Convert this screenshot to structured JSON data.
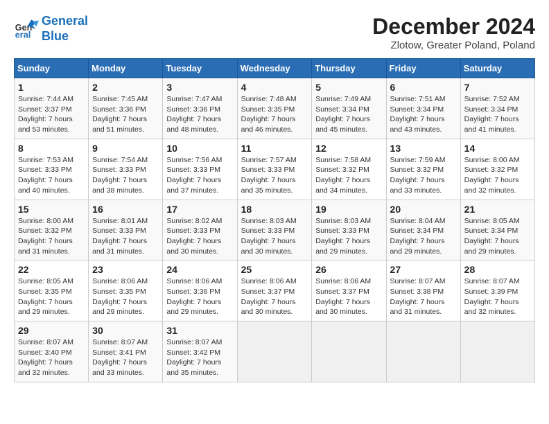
{
  "header": {
    "logo_line1": "General",
    "logo_line2": "Blue",
    "title": "December 2024",
    "subtitle": "Zlotow, Greater Poland, Poland"
  },
  "weekdays": [
    "Sunday",
    "Monday",
    "Tuesday",
    "Wednesday",
    "Thursday",
    "Friday",
    "Saturday"
  ],
  "weeks": [
    [
      {
        "day": "1",
        "sunrise": "7:44 AM",
        "sunset": "3:37 PM",
        "daylight": "7 hours and 53 minutes."
      },
      {
        "day": "2",
        "sunrise": "7:45 AM",
        "sunset": "3:36 PM",
        "daylight": "7 hours and 51 minutes."
      },
      {
        "day": "3",
        "sunrise": "7:47 AM",
        "sunset": "3:36 PM",
        "daylight": "7 hours and 48 minutes."
      },
      {
        "day": "4",
        "sunrise": "7:48 AM",
        "sunset": "3:35 PM",
        "daylight": "7 hours and 46 minutes."
      },
      {
        "day": "5",
        "sunrise": "7:49 AM",
        "sunset": "3:34 PM",
        "daylight": "7 hours and 45 minutes."
      },
      {
        "day": "6",
        "sunrise": "7:51 AM",
        "sunset": "3:34 PM",
        "daylight": "7 hours and 43 minutes."
      },
      {
        "day": "7",
        "sunrise": "7:52 AM",
        "sunset": "3:34 PM",
        "daylight": "7 hours and 41 minutes."
      }
    ],
    [
      {
        "day": "8",
        "sunrise": "7:53 AM",
        "sunset": "3:33 PM",
        "daylight": "7 hours and 40 minutes."
      },
      {
        "day": "9",
        "sunrise": "7:54 AM",
        "sunset": "3:33 PM",
        "daylight": "7 hours and 38 minutes."
      },
      {
        "day": "10",
        "sunrise": "7:56 AM",
        "sunset": "3:33 PM",
        "daylight": "7 hours and 37 minutes."
      },
      {
        "day": "11",
        "sunrise": "7:57 AM",
        "sunset": "3:33 PM",
        "daylight": "7 hours and 35 minutes."
      },
      {
        "day": "12",
        "sunrise": "7:58 AM",
        "sunset": "3:32 PM",
        "daylight": "7 hours and 34 minutes."
      },
      {
        "day": "13",
        "sunrise": "7:59 AM",
        "sunset": "3:32 PM",
        "daylight": "7 hours and 33 minutes."
      },
      {
        "day": "14",
        "sunrise": "8:00 AM",
        "sunset": "3:32 PM",
        "daylight": "7 hours and 32 minutes."
      }
    ],
    [
      {
        "day": "15",
        "sunrise": "8:00 AM",
        "sunset": "3:32 PM",
        "daylight": "7 hours and 31 minutes."
      },
      {
        "day": "16",
        "sunrise": "8:01 AM",
        "sunset": "3:33 PM",
        "daylight": "7 hours and 31 minutes."
      },
      {
        "day": "17",
        "sunrise": "8:02 AM",
        "sunset": "3:33 PM",
        "daylight": "7 hours and 30 minutes."
      },
      {
        "day": "18",
        "sunrise": "8:03 AM",
        "sunset": "3:33 PM",
        "daylight": "7 hours and 30 minutes."
      },
      {
        "day": "19",
        "sunrise": "8:03 AM",
        "sunset": "3:33 PM",
        "daylight": "7 hours and 29 minutes."
      },
      {
        "day": "20",
        "sunrise": "8:04 AM",
        "sunset": "3:34 PM",
        "daylight": "7 hours and 29 minutes."
      },
      {
        "day": "21",
        "sunrise": "8:05 AM",
        "sunset": "3:34 PM",
        "daylight": "7 hours and 29 minutes."
      }
    ],
    [
      {
        "day": "22",
        "sunrise": "8:05 AM",
        "sunset": "3:35 PM",
        "daylight": "7 hours and 29 minutes."
      },
      {
        "day": "23",
        "sunrise": "8:06 AM",
        "sunset": "3:35 PM",
        "daylight": "7 hours and 29 minutes."
      },
      {
        "day": "24",
        "sunrise": "8:06 AM",
        "sunset": "3:36 PM",
        "daylight": "7 hours and 29 minutes."
      },
      {
        "day": "25",
        "sunrise": "8:06 AM",
        "sunset": "3:37 PM",
        "daylight": "7 hours and 30 minutes."
      },
      {
        "day": "26",
        "sunrise": "8:06 AM",
        "sunset": "3:37 PM",
        "daylight": "7 hours and 30 minutes."
      },
      {
        "day": "27",
        "sunrise": "8:07 AM",
        "sunset": "3:38 PM",
        "daylight": "7 hours and 31 minutes."
      },
      {
        "day": "28",
        "sunrise": "8:07 AM",
        "sunset": "3:39 PM",
        "daylight": "7 hours and 32 minutes."
      }
    ],
    [
      {
        "day": "29",
        "sunrise": "8:07 AM",
        "sunset": "3:40 PM",
        "daylight": "7 hours and 32 minutes."
      },
      {
        "day": "30",
        "sunrise": "8:07 AM",
        "sunset": "3:41 PM",
        "daylight": "7 hours and 33 minutes."
      },
      {
        "day": "31",
        "sunrise": "8:07 AM",
        "sunset": "3:42 PM",
        "daylight": "7 hours and 35 minutes."
      },
      null,
      null,
      null,
      null
    ]
  ]
}
